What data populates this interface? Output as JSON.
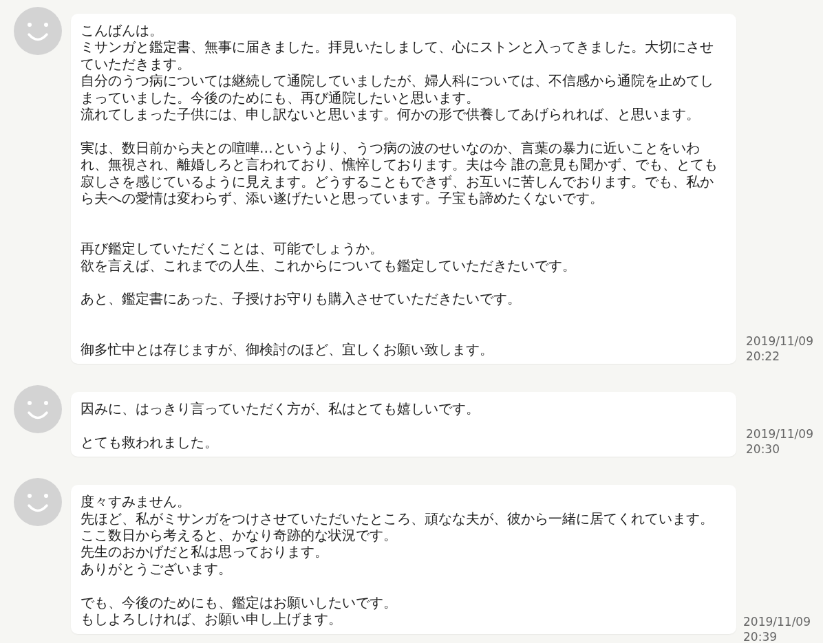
{
  "messages": [
    {
      "paragraphs": [
        {
          "kind": "first",
          "lines": [
            "こんばんは。",
            "ミサンガと鑑定書、無事に届きました。拝見いたしまして、心にストンと入ってきました。大切にさせていただきます。",
            "自分のうつ病については継続して通院していましたが、婦人科については、不信感から通院を止めてしまっていました。今後のためにも、再び通院したいと思います。",
            "流れてしまった子供には、申し訳ないと思います。何かの形で供養してあげられれば、と思います。"
          ]
        },
        {
          "kind": "gap",
          "lines": [
            "実は、数日前から夫との喧嘩…というより、うつ病の波のせいなのか、言葉の暴力に近いことをいわれ、無視され、離婚しろと言われており、憔悴しております。夫は今 誰の意見も聞かず、でも、とても寂しさを感じているように見えます。どうすることもできず、お互いに苦しんでおります。でも、私から夫への愛情は変わらず、添い遂げたいと思っています。子宝も諦めたくないです。"
          ]
        },
        {
          "kind": "double_gap",
          "lines": [
            "再び鑑定していただくことは、可能でしょうか。",
            "欲を言えば、これまでの人生、これからについても鑑定していただきたいです。"
          ]
        },
        {
          "kind": "gap",
          "lines": [
            "あと、鑑定書にあった、子授けお守りも購入させていただきたいです。"
          ]
        },
        {
          "kind": "double_gap",
          "lines": [
            "御多忙中とは存じますが、御検討のほど、宜しくお願い致します。"
          ]
        }
      ],
      "date": "2019/11/09",
      "time": "20:22"
    },
    {
      "paragraphs": [
        {
          "kind": "first",
          "lines": [
            "因みに、はっきり言っていただく方が、私はとても嬉しいです。"
          ]
        },
        {
          "kind": "gap",
          "lines": [
            "とても救われました。"
          ]
        }
      ],
      "date": "2019/11/09",
      "time": "20:30"
    },
    {
      "paragraphs": [
        {
          "kind": "first",
          "lines": [
            "度々すみません。",
            "先ほど、私がミサンガをつけさせていただいたところ、頑なな夫が、彼から一緒に居てくれています。",
            "ここ数日から考えると、かなり奇跡的な状況です。",
            "先生のおかげだと私は思っております。",
            "ありがとうございます。"
          ]
        },
        {
          "kind": "gap",
          "lines": [
            "でも、今後のためにも、鑑定はお願いしたいです。",
            "もしよろしければ、お願い申し上げます。"
          ]
        }
      ],
      "date": "2019/11/09",
      "time": "20:39"
    }
  ]
}
